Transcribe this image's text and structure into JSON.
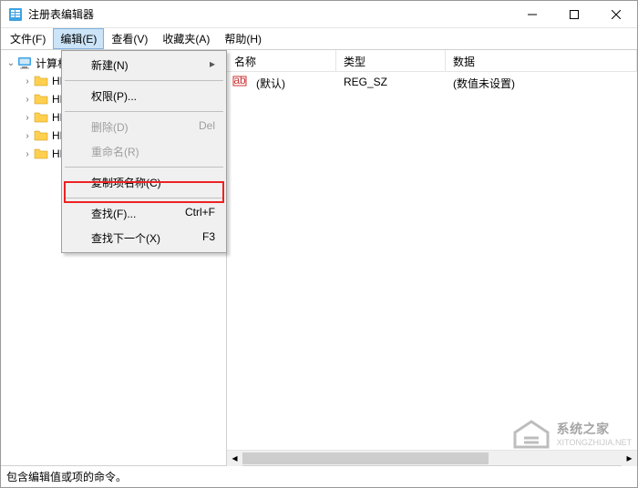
{
  "window": {
    "title": "注册表编辑器"
  },
  "menubar": [
    "文件(F)",
    "编辑(E)",
    "查看(V)",
    "收藏夹(A)",
    "帮助(H)"
  ],
  "dropdown": {
    "new": {
      "label": "新建(N)"
    },
    "perm": {
      "label": "权限(P)..."
    },
    "delete": {
      "label": "删除(D)",
      "accel": "Del"
    },
    "rename": {
      "label": "重命名(R)"
    },
    "copykey": {
      "label": "复制项名称(C)"
    },
    "find": {
      "label": "查找(F)...",
      "accel": "Ctrl+F"
    },
    "findnext": {
      "label": "查找下一个(X)",
      "accel": "F3"
    }
  },
  "columns": {
    "name": "名称",
    "type": "类型",
    "data": "数据"
  },
  "tree": {
    "root": "计算机",
    "hives": [
      "HKEY_CLASSES_ROOT",
      "HKEY_CURRENT_USER",
      "HKEY_LOCAL_MACHINE",
      "HKEY_USERS",
      "HKEY_CURRENT_CONFIG"
    ]
  },
  "row": {
    "name": "(默认)",
    "type": "REG_SZ",
    "data": "(数值未设置)"
  },
  "status": "包含编辑值或项的命令。",
  "watermark": {
    "name": "系统之家",
    "sub": "XITONGZHIJIA.NET"
  }
}
